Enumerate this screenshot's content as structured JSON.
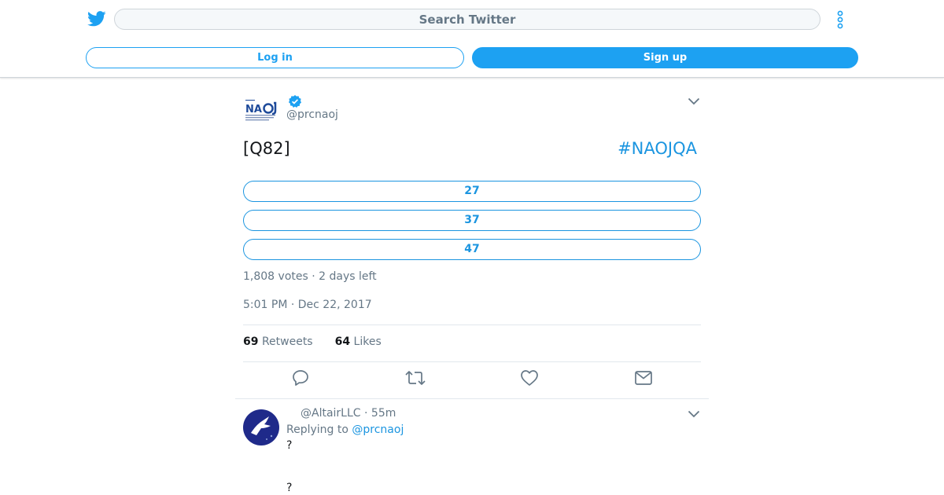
{
  "header": {
    "search_placeholder": "Search Twitter",
    "login_label": "Log in",
    "signup_label": "Sign up"
  },
  "tweet": {
    "handle": "@prcnaoj",
    "text": "[Q82]",
    "hashtag": "#NAOJQA",
    "poll": {
      "options": [
        "27",
        "37",
        "47"
      ],
      "summary": "1,808 votes · 2 days left"
    },
    "timestamp": "5:01 PM · Dec 22, 2017",
    "retweets_count": "69",
    "retweets_label": "Retweets",
    "likes_count": "64",
    "likes_label": "Likes"
  },
  "reply": {
    "handle": "@AltairLLC",
    "time": "· 55m",
    "replying_prefix": "Replying to",
    "replying_handle": "@prcnaoj",
    "lines": [
      "?",
      "?"
    ]
  },
  "colors": {
    "accent": "#1da1f2",
    "link": "#1b95e0",
    "muted": "#657786",
    "text": "#14171a",
    "border": "#e1e8ed"
  },
  "icons": {
    "logo": "twitter-bird-icon",
    "more": "more-vertical-icon",
    "verified": "verified-badge-icon",
    "caret": "chevron-down-icon",
    "reply": "reply-icon",
    "retweet": "retweet-icon",
    "like": "heart-icon",
    "dm": "envelope-icon"
  }
}
